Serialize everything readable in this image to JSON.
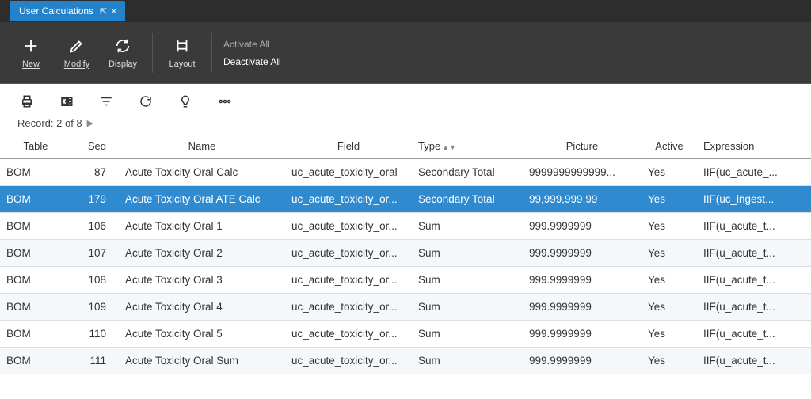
{
  "tab": {
    "title": "User Calculations"
  },
  "toolbar": {
    "new": "New",
    "modify": "Modify",
    "display": "Display",
    "layout": "Layout",
    "activate_all": "Activate All",
    "deactivate_all": "Deactivate All"
  },
  "record_status": "Record: 2 of 8",
  "columns": {
    "table": "Table",
    "seq": "Seq",
    "name": "Name",
    "field": "Field",
    "type": "Type",
    "picture": "Picture",
    "active": "Active",
    "expression": "Expression"
  },
  "rows": [
    {
      "table": "BOM",
      "seq": "87",
      "name": "Acute Toxicity Oral Calc",
      "field": "uc_acute_toxicity_oral",
      "type": "Secondary Total",
      "picture": "9999999999999...",
      "active": "Yes",
      "expression": "IIF(uc_acute_..."
    },
    {
      "table": "BOM",
      "seq": "179",
      "name": "Acute Toxicity Oral ATE Calc",
      "field": "uc_acute_toxicity_or...",
      "type": "Secondary Total",
      "picture": "99,999,999.99",
      "active": "Yes",
      "expression": "IIF(uc_ingest..."
    },
    {
      "table": "BOM",
      "seq": "106",
      "name": "Acute Toxicity Oral 1",
      "field": "uc_acute_toxicity_or...",
      "type": "Sum",
      "picture": "999.9999999",
      "active": "Yes",
      "expression": "IIF(u_acute_t..."
    },
    {
      "table": "BOM",
      "seq": "107",
      "name": "Acute Toxicity Oral 2",
      "field": "uc_acute_toxicity_or...",
      "type": "Sum",
      "picture": "999.9999999",
      "active": "Yes",
      "expression": "IIF(u_acute_t..."
    },
    {
      "table": "BOM",
      "seq": "108",
      "name": "Acute Toxicity Oral 3",
      "field": "uc_acute_toxicity_or...",
      "type": "Sum",
      "picture": "999.9999999",
      "active": "Yes",
      "expression": "IIF(u_acute_t..."
    },
    {
      "table": "BOM",
      "seq": "109",
      "name": "Acute Toxicity Oral 4",
      "field": "uc_acute_toxicity_or...",
      "type": "Sum",
      "picture": "999.9999999",
      "active": "Yes",
      "expression": "IIF(u_acute_t..."
    },
    {
      "table": "BOM",
      "seq": "110",
      "name": "Acute Toxicity Oral 5",
      "field": "uc_acute_toxicity_or...",
      "type": "Sum",
      "picture": "999.9999999",
      "active": "Yes",
      "expression": "IIF(u_acute_t..."
    },
    {
      "table": "BOM",
      "seq": "111",
      "name": "Acute Toxicity Oral Sum",
      "field": "uc_acute_toxicity_or...",
      "type": "Sum",
      "picture": "999.9999999",
      "active": "Yes",
      "expression": "IIF(u_acute_t..."
    }
  ],
  "selected_index": 1
}
